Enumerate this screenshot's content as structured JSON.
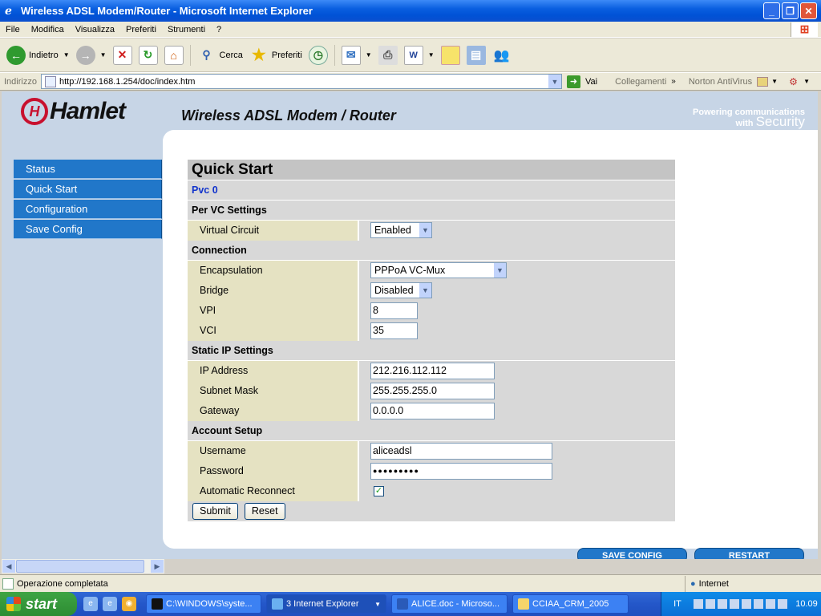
{
  "window": {
    "title": "Wireless ADSL Modem/Router - Microsoft Internet Explorer"
  },
  "menu": [
    "File",
    "Modifica",
    "Visualizza",
    "Preferiti",
    "Strumenti",
    "?"
  ],
  "toolbar": {
    "back": "Indietro",
    "search": "Cerca",
    "favorites": "Preferiti"
  },
  "address": {
    "label": "Indirizzo",
    "url": "http://192.168.1.254/doc/index.htm",
    "go": "Vai",
    "links": "Collegamenti",
    "norton": "Norton AntiVirus"
  },
  "page": {
    "brand": "Hamlet",
    "product_title": "Wireless ADSL Modem / Router",
    "powering": "Powering communications",
    "with": "with",
    "security": "Security",
    "nav": [
      "Status",
      "Quick Start",
      "Configuration",
      "Save Config"
    ],
    "form": {
      "title": "Quick Start",
      "pvc": "Pvc 0",
      "per_vc": "Per VC Settings",
      "virtual_circuit": {
        "label": "Virtual Circuit",
        "value": "Enabled"
      },
      "connection": "Connection",
      "encapsulation": {
        "label": "Encapsulation",
        "value": "PPPoA VC-Mux"
      },
      "bridge": {
        "label": "Bridge",
        "value": "Disabled"
      },
      "vpi": {
        "label": "VPI",
        "value": "8"
      },
      "vci": {
        "label": "VCI",
        "value": "35"
      },
      "static_ip": "Static IP Settings",
      "ip": {
        "label": "IP Address",
        "value": "212.216.112.112"
      },
      "mask": {
        "label": "Subnet Mask",
        "value": "255.255.255.0"
      },
      "gateway": {
        "label": "Gateway",
        "value": "0.0.0.0"
      },
      "account": "Account Setup",
      "username": {
        "label": "Username",
        "value": "aliceadsl"
      },
      "password": {
        "label": "Password",
        "value": "●●●●●●●●●"
      },
      "reconnect": {
        "label": "Automatic Reconnect",
        "checked": true
      },
      "submit": "Submit",
      "reset": "Reset"
    },
    "save_config_btn": "SAVE CONFIG",
    "restart_btn": "RESTART"
  },
  "status": {
    "message": "Operazione completata",
    "zone": "Internet"
  },
  "taskbar": {
    "start": "start",
    "tasks": [
      "C:\\WINDOWS\\syste...",
      "3 Internet Explorer",
      "ALICE.doc - Microso...",
      "CCIAA_CRM_2005"
    ],
    "lang": "IT",
    "clock": "10.09"
  }
}
